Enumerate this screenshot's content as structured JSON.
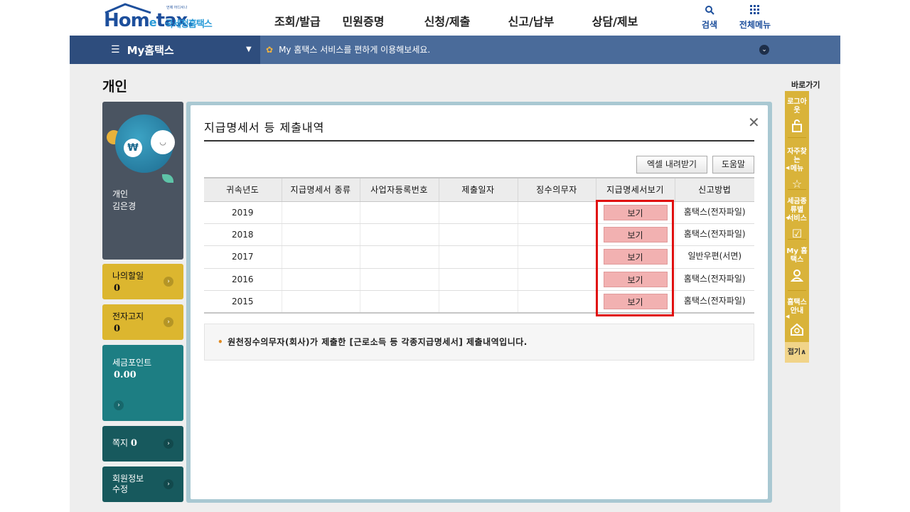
{
  "header": {
    "logo_tagline": "언제 어디서나",
    "logo_brand_a": "Hom",
    "logo_brand_e": "e",
    "logo_brand_b": "tax.",
    "logo_kr": "국세청홈택스",
    "nav": [
      "조회/발급",
      "민원증명",
      "신청/제출",
      "신고/납부",
      "상담/제보"
    ],
    "search_label": "검색",
    "all_menu_label": "전체메뉴"
  },
  "bar": {
    "my_label": "My홈택스",
    "notice": "My 홈택스 서비스를 편하게 이용해보세요."
  },
  "page_title": "개인",
  "profile": {
    "type": "개인",
    "name": "김은경"
  },
  "left_boxes": {
    "todo": {
      "label": "나의할일",
      "value": "0"
    },
    "ebill": {
      "label": "전자고지",
      "value": "0"
    },
    "points": {
      "label": "세금포인트",
      "value": "0.00"
    },
    "message": {
      "label": "쪽지",
      "value": "0"
    },
    "member": {
      "label_1": "회원정보",
      "label_2": "수정"
    }
  },
  "modal": {
    "title": "지급명세서 등 제출내역",
    "excel_button": "엑셀 내려받기",
    "help_button": "도움말",
    "columns": [
      "귀속년도",
      "지급명세서 종류",
      "사업자등록번호",
      "제출일자",
      "징수의무자",
      "지급명세서보기",
      "신고방법"
    ],
    "rows": [
      {
        "year": "2019",
        "kind": "",
        "bizno": "",
        "date": "",
        "payer": "",
        "view": "보기",
        "method": "홈택스(전자파일)"
      },
      {
        "year": "2018",
        "kind": "",
        "bizno": "",
        "date": "",
        "payer": "",
        "view": "보기",
        "method": "홈택스(전자파일)"
      },
      {
        "year": "2017",
        "kind": "",
        "bizno": "",
        "date": "",
        "payer": "",
        "view": "보기",
        "method": "일반우편(서면)"
      },
      {
        "year": "2016",
        "kind": "",
        "bizno": "",
        "date": "",
        "payer": "",
        "view": "보기",
        "method": "홈택스(전자파일)"
      },
      {
        "year": "2015",
        "kind": "",
        "bizno": "",
        "date": "",
        "payer": "",
        "view": "보기",
        "method": "홈택스(전자파일)"
      }
    ],
    "note": "원천징수의무자(회사)가 제출한 [근로소득 등 각종지급명세서] 제출내역입니다."
  },
  "quick": {
    "title": "바로가기",
    "logout": "로그아웃",
    "favorites_1": "자주찾는",
    "favorites_2": "메뉴",
    "tax_1": "세금종류별",
    "tax_2": "서비스",
    "my": "My 홈택스",
    "guide": "홈택스안내",
    "fold": "접기∧"
  },
  "colors": {
    "brand_blue": "#1d4f9c",
    "bar_blue": "#4a6b9a",
    "highlight_red": "#e01010",
    "view_button": "#f2b1b1",
    "quick_gold": "#d9b33a"
  }
}
